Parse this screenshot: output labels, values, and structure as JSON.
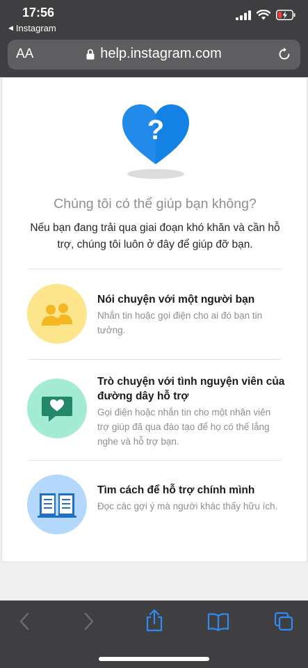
{
  "status_bar": {
    "time": "17:56",
    "back_app": "Instagram"
  },
  "url_bar": {
    "text_size_label": "AA",
    "domain": "help.instagram.com"
  },
  "content": {
    "headline": "Chúng tôi có thể giúp bạn không?",
    "intro": "Nếu bạn đang trải qua giai đoạn khó khăn và cần hỗ trợ, chúng tôi luôn ở đây để giúp đỡ bạn.",
    "options": [
      {
        "title": "Nói chuyện với một người bạn",
        "description": "Nhắn tin hoặc gọi điện cho ai đó bạn tin tưởng.",
        "icon": "friends-icon",
        "color": "#fde58c"
      },
      {
        "title": "Trò chuyện với tình nguyện viên của đường dây hỗ trợ",
        "description": "Gọi điện hoặc nhắn tin cho một nhân viên trợ giúp đã qua đào tạo để họ có thể lắng nghe và hỗ trợ bạn.",
        "icon": "chat-heart-icon",
        "color": "#a3ecd3"
      },
      {
        "title": "Tìm cách để hỗ trợ chính mình",
        "description": "Đọc các gợi ý mà người khác thấy hữu ích.",
        "icon": "open-book-icon",
        "color": "#b3d8fb"
      }
    ]
  },
  "colors": {
    "heart": "#1482e5",
    "toolbar_icon": "#2f8bf3",
    "toolbar_icon_disabled": "#6c6c70"
  }
}
